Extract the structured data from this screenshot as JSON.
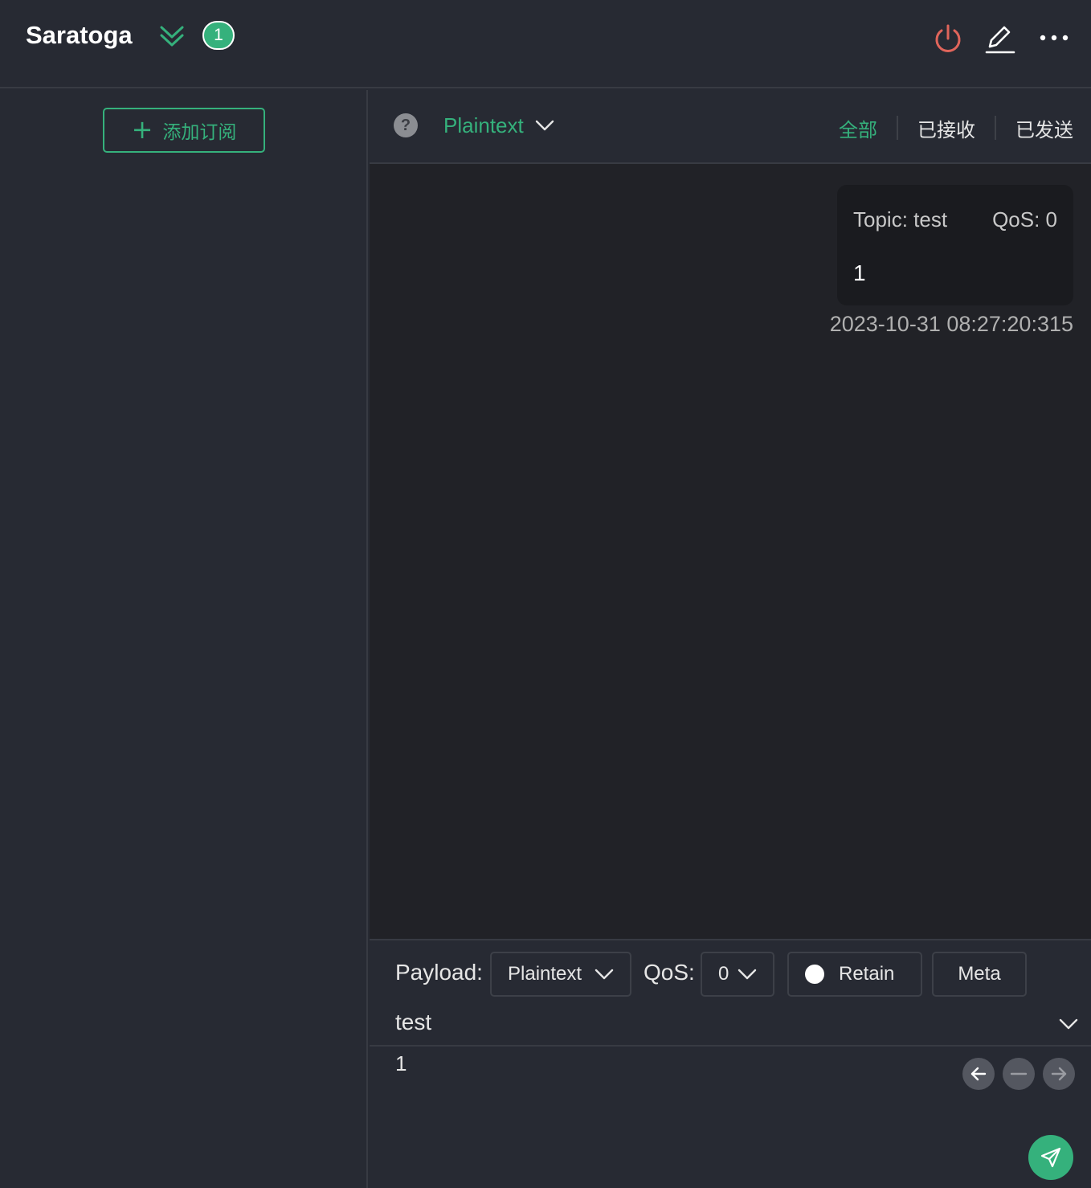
{
  "header": {
    "connection_name": "Saratoga",
    "badge_count": "1",
    "icons": [
      "chevrons-down-icon",
      "power-icon",
      "edit-icon",
      "more-icon"
    ]
  },
  "left_panel": {
    "add_subscription_label": "添加订阅"
  },
  "filter_bar": {
    "format": "Plaintext",
    "tabs": [
      {
        "label": "全部",
        "active": true
      },
      {
        "label": "已接收",
        "active": false
      },
      {
        "label": "已发送",
        "active": false
      }
    ]
  },
  "messages": [
    {
      "topic": "Topic: test",
      "qos": "QoS: 0",
      "payload": "1",
      "time": "2023-10-31 08:27:20:315"
    }
  ],
  "publish": {
    "payload_label": "Payload:",
    "payload_format": "Plaintext",
    "qos_label": "QoS:",
    "qos_value": "0",
    "retain_label": "Retain",
    "meta_label": "Meta",
    "topic": "test",
    "payload": "1"
  },
  "colors": {
    "accent": "#35b17c",
    "danger": "#e0655b",
    "background": "#272a33",
    "message_area": "#212227"
  }
}
